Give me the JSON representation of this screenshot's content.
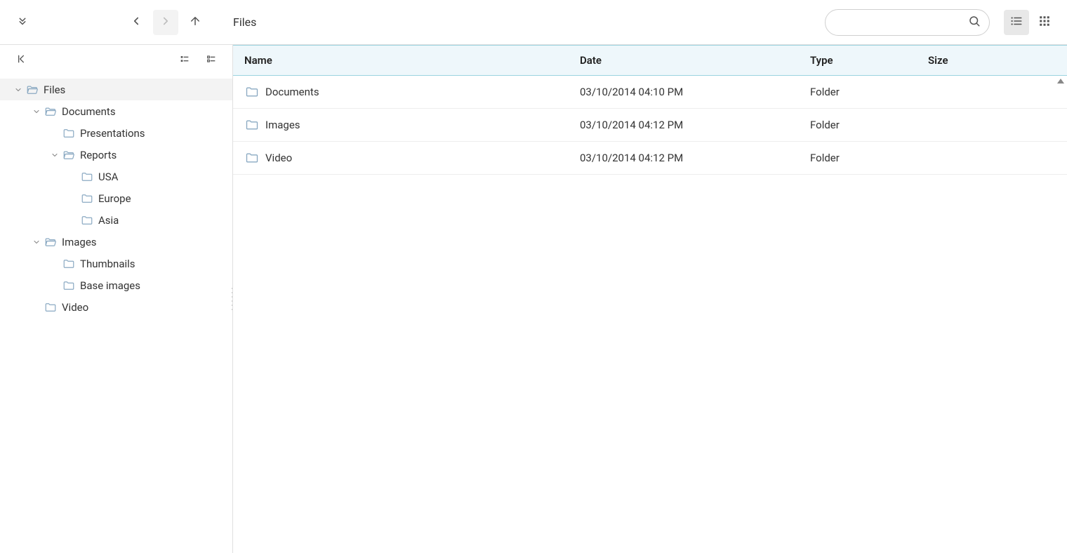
{
  "toolbar": {
    "breadcrumb": "Files",
    "search_placeholder": ""
  },
  "columns": {
    "name": "Name",
    "date": "Date",
    "type": "Type",
    "size": "Size"
  },
  "tree": [
    {
      "label": "Files",
      "depth": 0,
      "expanded": true,
      "open": true,
      "selected": true
    },
    {
      "label": "Documents",
      "depth": 1,
      "expanded": true,
      "open": true,
      "selected": false
    },
    {
      "label": "Presentations",
      "depth": 2,
      "expanded": null,
      "open": false,
      "selected": false
    },
    {
      "label": "Reports",
      "depth": 2,
      "expanded": true,
      "open": true,
      "selected": false
    },
    {
      "label": "USA",
      "depth": 3,
      "expanded": null,
      "open": false,
      "selected": false
    },
    {
      "label": "Europe",
      "depth": 3,
      "expanded": null,
      "open": false,
      "selected": false
    },
    {
      "label": "Asia",
      "depth": 3,
      "expanded": null,
      "open": false,
      "selected": false
    },
    {
      "label": "Images",
      "depth": 1,
      "expanded": true,
      "open": true,
      "selected": false
    },
    {
      "label": "Thumbnails",
      "depth": 2,
      "expanded": null,
      "open": false,
      "selected": false
    },
    {
      "label": "Base images",
      "depth": 2,
      "expanded": null,
      "open": false,
      "selected": false
    },
    {
      "label": "Video",
      "depth": 1,
      "expanded": null,
      "open": false,
      "selected": false
    }
  ],
  "rows": [
    {
      "name": "Documents",
      "date": "03/10/2014 04:10 PM",
      "type": "Folder",
      "size": ""
    },
    {
      "name": "Images",
      "date": "03/10/2014 04:12 PM",
      "type": "Folder",
      "size": ""
    },
    {
      "name": "Video",
      "date": "03/10/2014 04:12 PM",
      "type": "Folder",
      "size": ""
    }
  ]
}
